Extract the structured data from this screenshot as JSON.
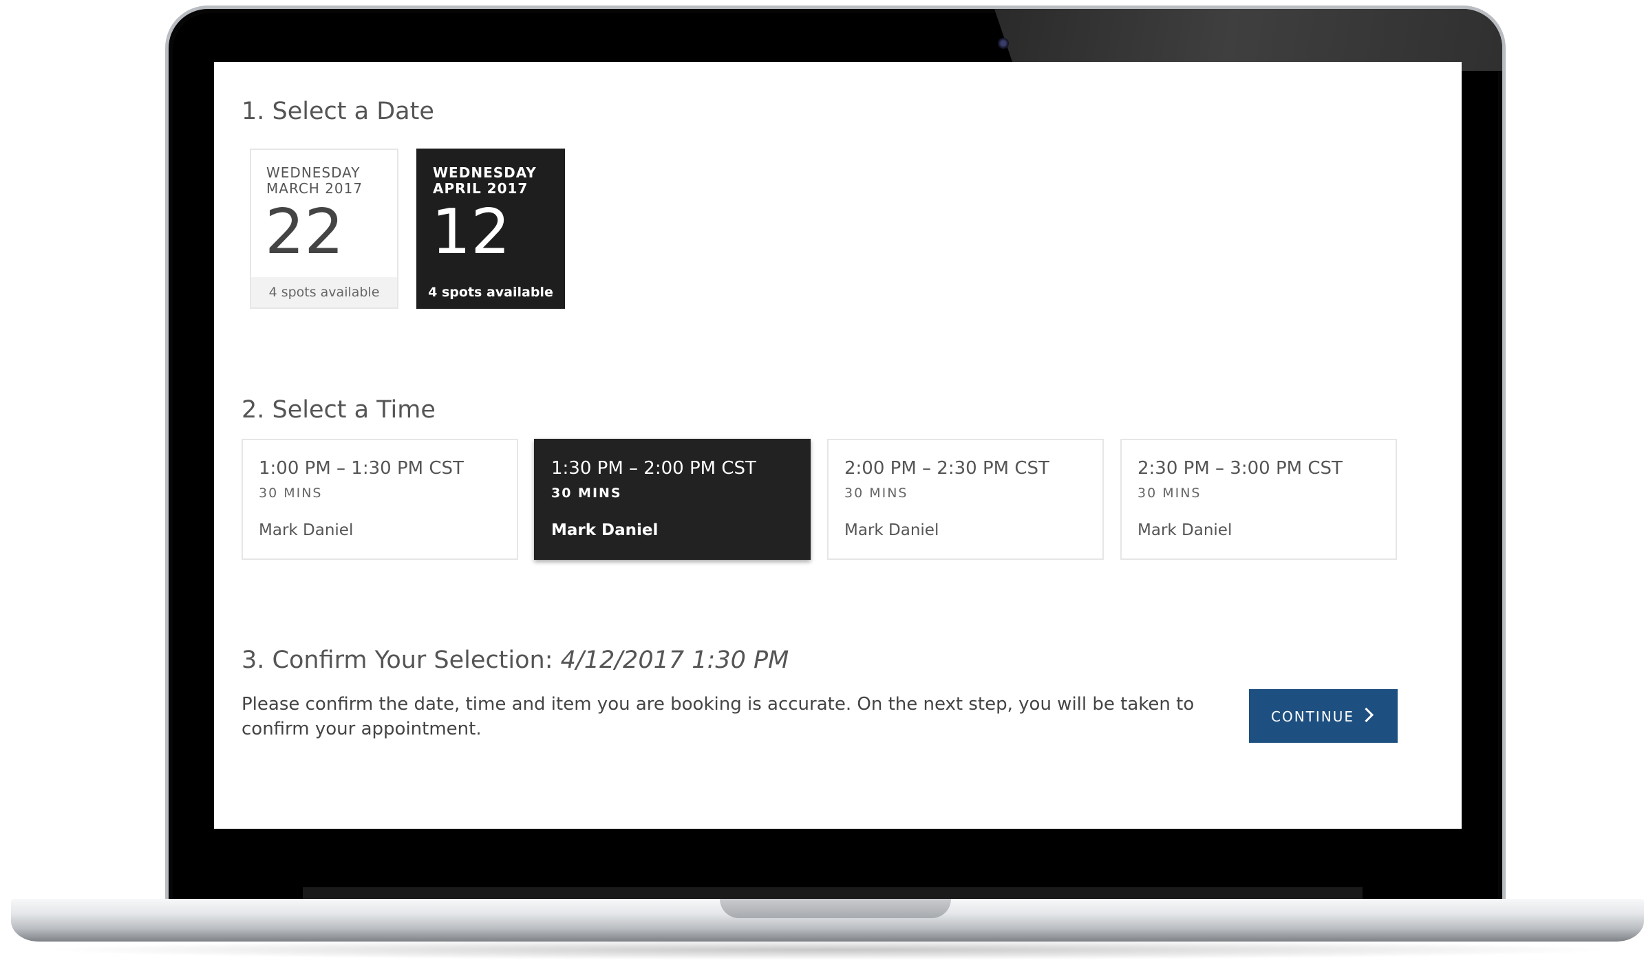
{
  "step1": {
    "title": "1. Select a Date",
    "dates": [
      {
        "dow": "WEDNESDAY",
        "month": "MARCH 2017",
        "day": "22",
        "spots": "4 spots available",
        "selected": false
      },
      {
        "dow": "WEDNESDAY",
        "month": "APRIL 2017",
        "day": "12",
        "spots": "4 spots available",
        "selected": true
      }
    ]
  },
  "step2": {
    "title": "2. Select a Time",
    "slots": [
      {
        "range": "1:00 PM – 1:30 PM CST",
        "duration": "30 MINS",
        "host": "Mark Daniel",
        "selected": false
      },
      {
        "range": "1:30 PM – 2:00 PM CST",
        "duration": "30 MINS",
        "host": "Mark Daniel",
        "selected": true
      },
      {
        "range": "2:00 PM – 2:30 PM CST",
        "duration": "30 MINS",
        "host": "Mark Daniel",
        "selected": false
      },
      {
        "range": "2:30 PM – 3:00 PM CST",
        "duration": "30 MINS",
        "host": "Mark Daniel",
        "selected": false
      }
    ]
  },
  "step3": {
    "title": "3. Confirm Your Selection:",
    "selection": "4/12/2017 1:30 PM",
    "description": "Please confirm the date, time and item you are booking is accurate. On the next step, you will be taken to confirm your appointment.",
    "continue_label": "CONTINUE"
  },
  "colors": {
    "accent": "#1d4f80",
    "selected_bg": "#1e1e1e",
    "text": "#555555"
  }
}
